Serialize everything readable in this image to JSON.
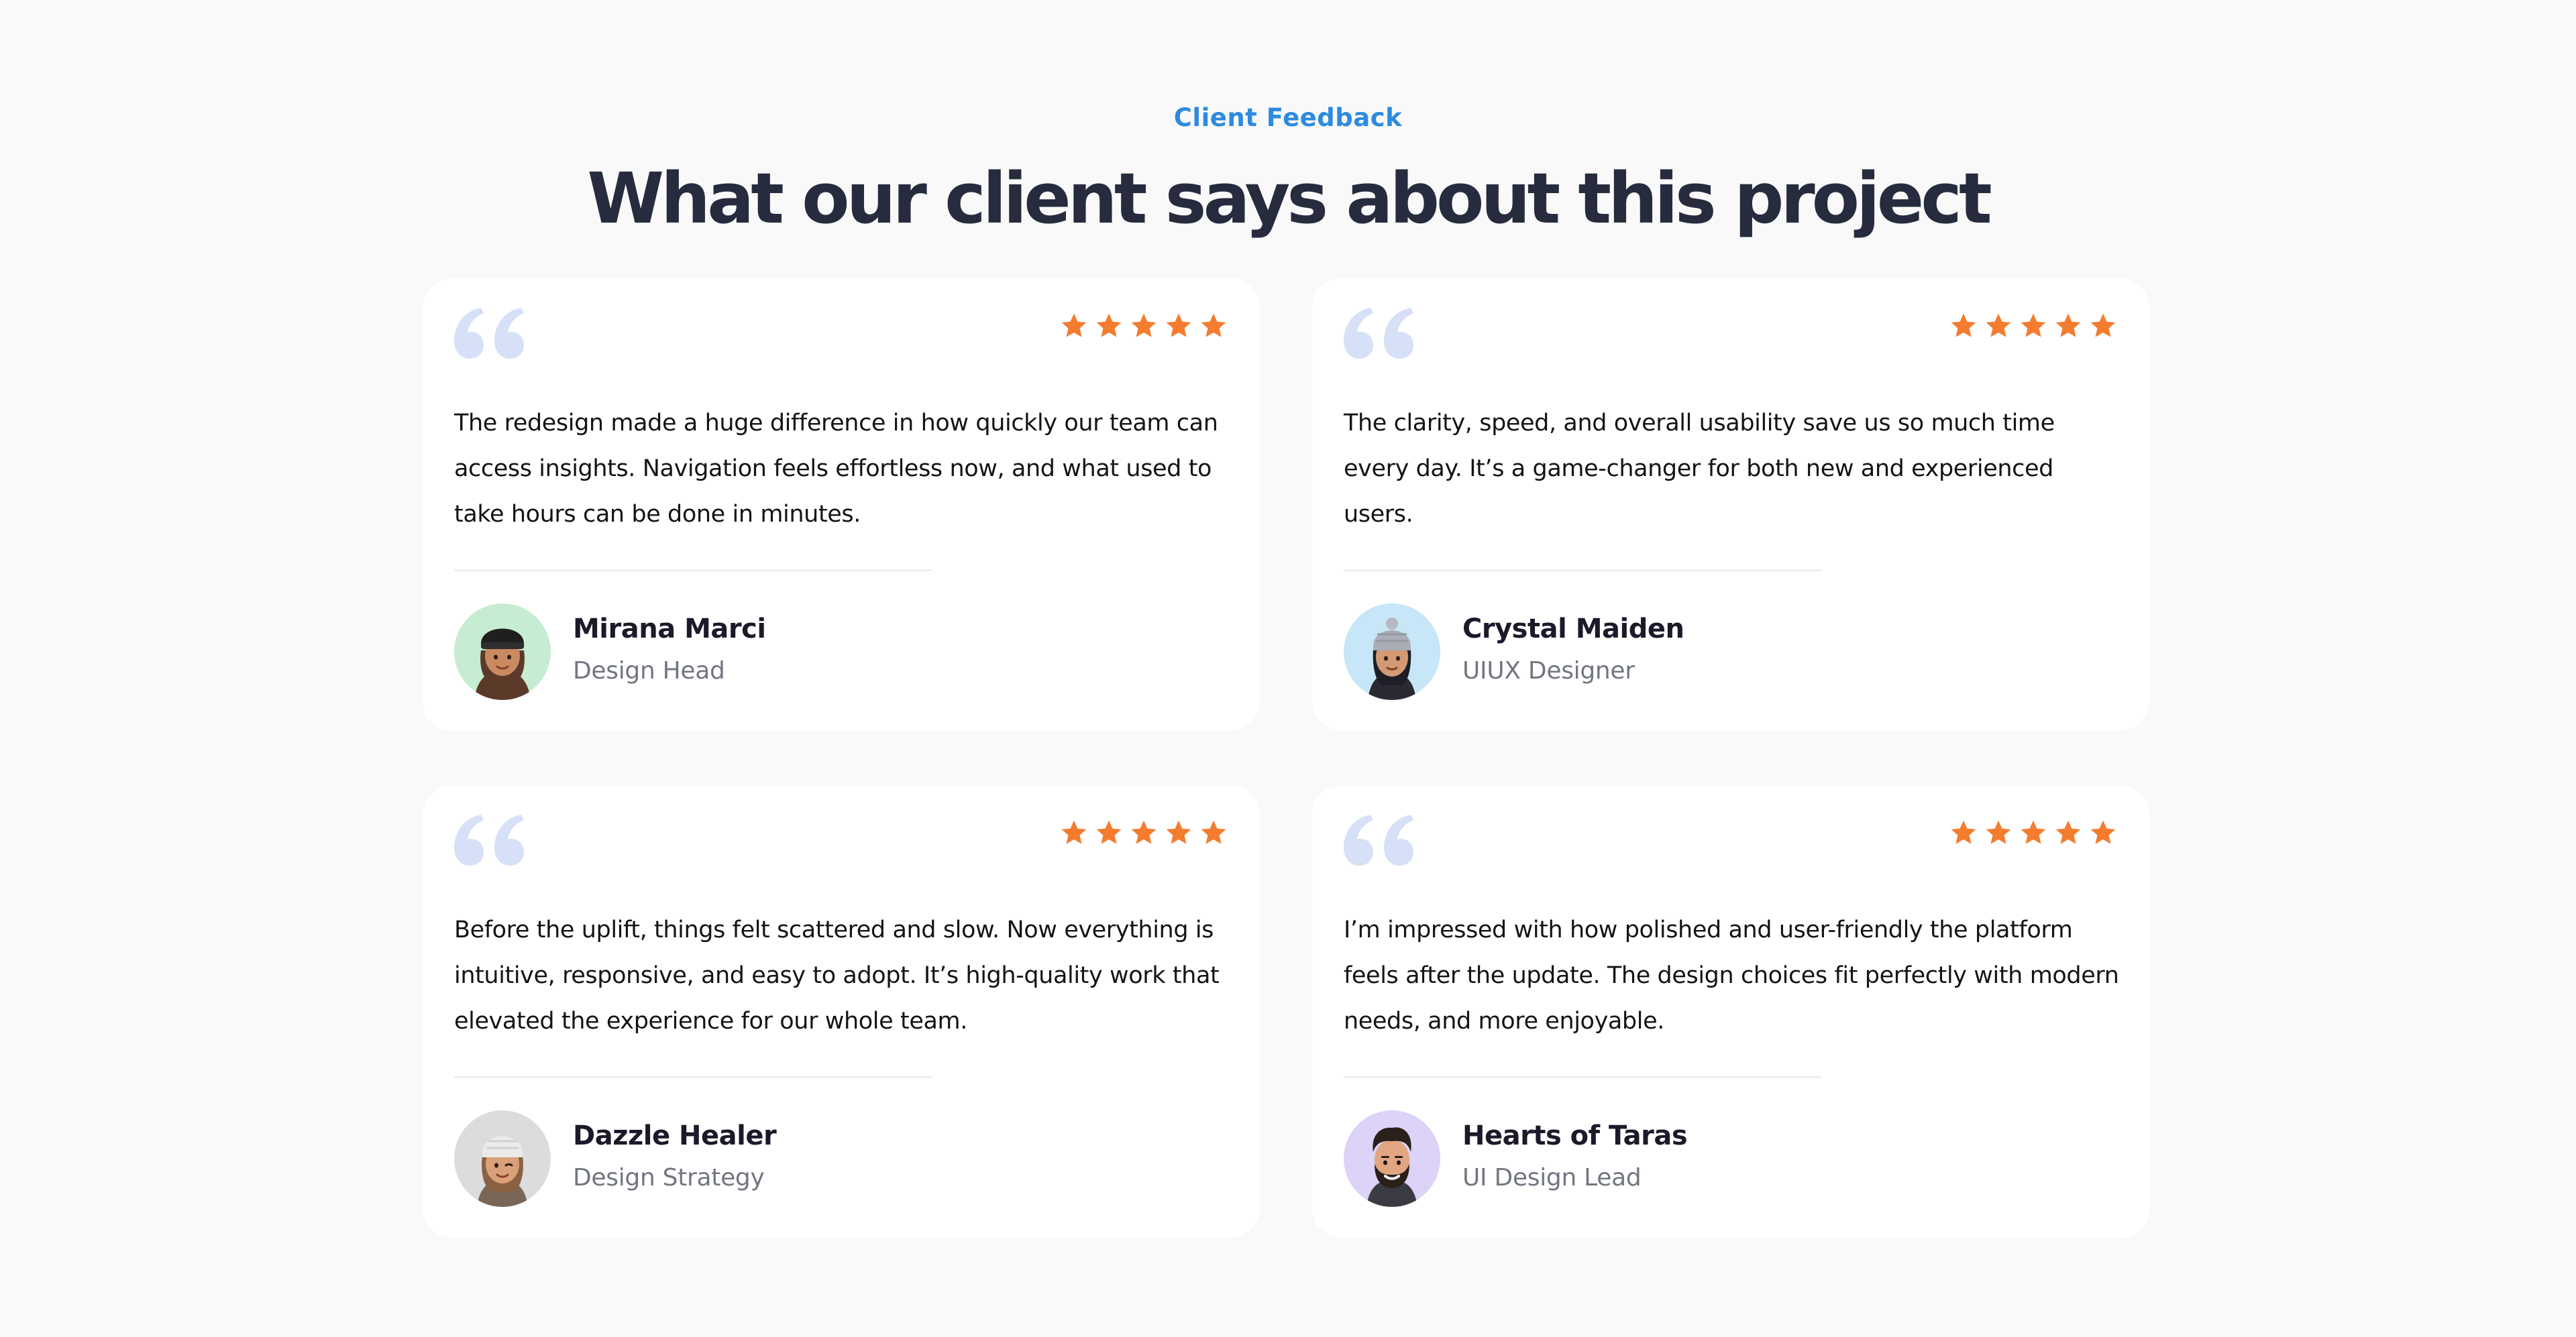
{
  "section": {
    "eyebrow": "Client Feedback",
    "title": "What our client says about this project"
  },
  "colors": {
    "accent": "#2d8ae0",
    "heading": "#262b3e",
    "star": "#f47c2f",
    "quote_icon": "#d6e1f7",
    "card": "#ffffff",
    "background": "#f9f9f9"
  },
  "testimonials": [
    {
      "rating": 5,
      "quote": "The redesign made a huge difference in how quickly our team can access insights. Navigation feels effortless now, and what used to take hours can be done in minutes.",
      "name": "Mirana Marci",
      "role": "Design Head",
      "avatar_icon": "avatar-woman-black-beanie-icon",
      "avatar_bg": "#c6ecd1"
    },
    {
      "rating": 5,
      "quote": "The clarity, speed, and overall usability save us so much time every day. It’s a game-changer for both new and experienced users.",
      "name": "Crystal Maiden",
      "role": "UIUX Designer",
      "avatar_icon": "avatar-woman-grey-beanie-icon",
      "avatar_bg": "#c7e6f7"
    },
    {
      "rating": 5,
      "quote": "Before the uplift, things felt scattered and slow. Now everything is intuitive, responsive, and easy to adopt. It’s high-quality work that elevated the experience for our whole team.",
      "name": "Dazzle Healer",
      "role": "Design Strategy",
      "avatar_icon": "avatar-woman-white-beanie-icon",
      "avatar_bg": "#dcdcdf"
    },
    {
      "rating": 5,
      "quote": "I’m impressed with how polished and user-friendly the platform feels after the update. The design choices fit perfectly with modern needs, and more enjoyable.",
      "name": "Hearts of Taras",
      "role": "UI Design Lead",
      "avatar_icon": "avatar-man-beard-icon",
      "avatar_bg": "#ddd2f7"
    }
  ]
}
